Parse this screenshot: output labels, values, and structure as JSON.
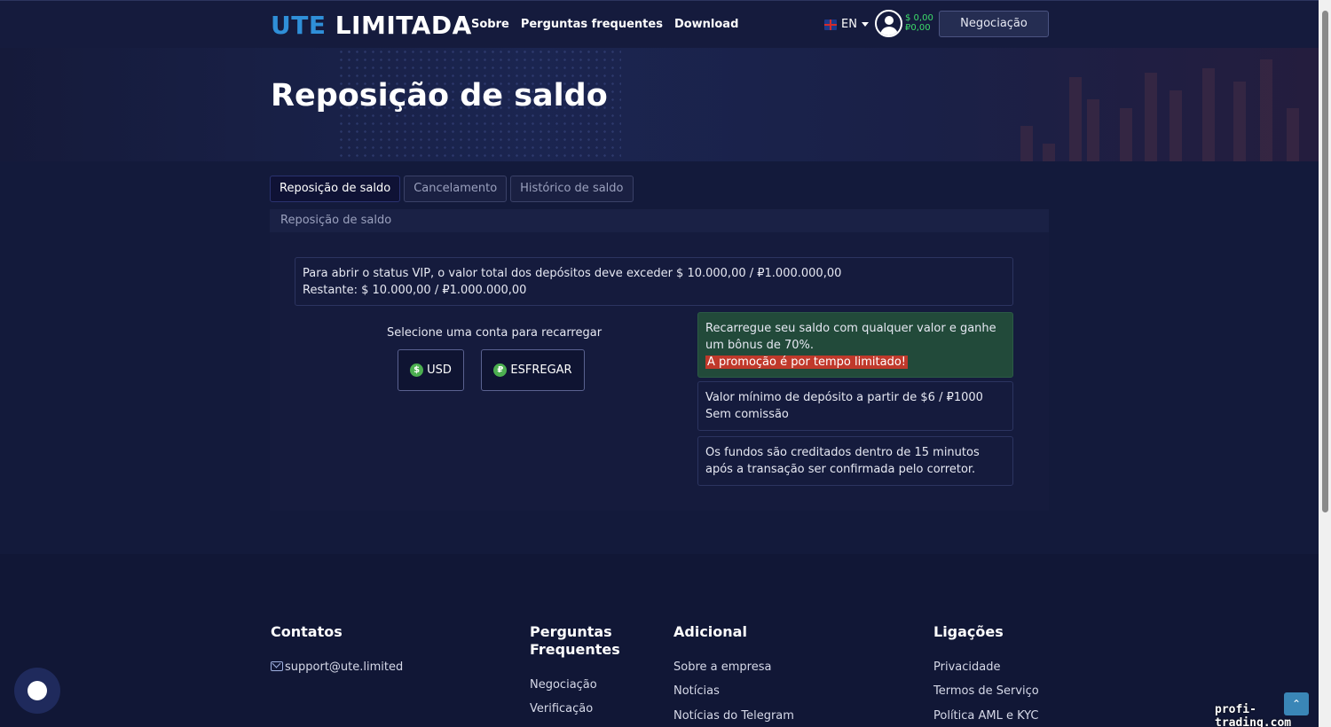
{
  "header": {
    "logo_part1": "UTE",
    "logo_part2": "LIMITADA",
    "nav": [
      "Sobre",
      "Perguntas frequentes",
      "Download"
    ],
    "language": "EN",
    "balance_usd": "$ 0,00",
    "balance_rub": "₽0,00",
    "trade_button": "Negociação"
  },
  "hero": {
    "title": "Reposição de saldo"
  },
  "tabs": [
    {
      "label": "Reposição de saldo",
      "active": true
    },
    {
      "label": "Cancelamento",
      "active": false
    },
    {
      "label": "Histórico de saldo",
      "active": false
    }
  ],
  "panel": {
    "heading": "Reposição de saldo",
    "vip_line1": "Para abrir o status VIP, o valor total dos depósitos deve exceder $ 10.000,00 / ₽1.000.000,00",
    "vip_line2": "Restante: $ 10.000,00 / ₽1.000.000,00",
    "select_label": "Selecione uma conta para recarregar",
    "accounts": [
      {
        "symbol": "$",
        "label": "USD"
      },
      {
        "symbol": "₽",
        "label": "ESFREGAR"
      }
    ],
    "promo_text": "Recarregue seu saldo com qualquer valor e ganhe um bônus de 70%.",
    "promo_highlight": "A promoção é por tempo limitado!",
    "min_line1": "Valor mínimo de depósito a partir de $6 / ₽1000",
    "min_line2": "Sem comissão",
    "time_text": "Os fundos são creditados dentro de 15 minutos após a transação ser confirmada pelo corretor."
  },
  "footer": {
    "contacts": {
      "title": "Contatos",
      "email": "support@ute.limited"
    },
    "faq": {
      "title_line1": "Perguntas",
      "title_line2": "Frequentes",
      "links": [
        "Negociação",
        "Verificação"
      ]
    },
    "extra": {
      "title": "Adicional",
      "links": [
        "Sobre a empresa",
        "Notícias",
        "Notícias do Telegram"
      ]
    },
    "legal": {
      "title": "Ligações",
      "links": [
        "Privacidade",
        "Termos de Serviço",
        "Política AML e KYC"
      ]
    }
  },
  "watermark": "profi-trading.com",
  "colors": {
    "accent_blue": "#2f8fd8",
    "balance_green": "#3ddc6a",
    "promo_bg": "#224a3a",
    "promo_highlight": "#c0392b"
  }
}
